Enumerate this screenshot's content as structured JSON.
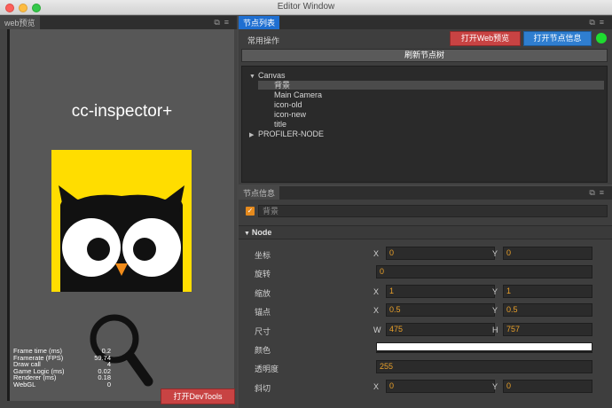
{
  "window": {
    "title": "Editor Window"
  },
  "left_panel": {
    "tab": "web预览",
    "game_title": "cc-inspector+",
    "stats": [
      {
        "label": "Frame time (ms)",
        "value": "0.2"
      },
      {
        "label": "Framerate (FPS)",
        "value": "59.74"
      },
      {
        "label": "Draw call",
        "value": "4"
      },
      {
        "label": "Game Logic (ms)",
        "value": "0.02"
      },
      {
        "label": "Renderer (ms)",
        "value": "0.18"
      },
      {
        "label": "WebGL",
        "value": "0"
      }
    ],
    "devtools_button": "打开DevTools"
  },
  "node_list": {
    "tab": "节点列表",
    "common_ops": "常用操作",
    "open_web_button": "打开Web预览",
    "open_info_button": "打开节点信息",
    "refresh_button": "刷新节点树",
    "tree": [
      {
        "label": "Canvas",
        "expanded": true,
        "children": [
          "背景",
          "Main Camera",
          "icon-old",
          "icon-new",
          "title"
        ]
      },
      {
        "label": "PROFILER-NODE",
        "expanded": false
      }
    ]
  },
  "node_info": {
    "tab": "节点信息",
    "node_name": "背景",
    "section": "Node",
    "props": {
      "position": {
        "label": "坐标",
        "x": "0",
        "y": "0"
      },
      "rotation": {
        "label": "旋转",
        "value": "0"
      },
      "scale": {
        "label": "缩放",
        "x": "1",
        "y": "1"
      },
      "anchor": {
        "label": "锚点",
        "x": "0.5",
        "y": "0.5"
      },
      "size": {
        "label": "尺寸",
        "w": "475",
        "h": "757"
      },
      "color": {
        "label": "颜色",
        "value": "#ffffff"
      },
      "opacity": {
        "label": "透明度",
        "value": "255"
      },
      "skew": {
        "label": "斜切",
        "x": "0",
        "y": "0"
      }
    },
    "axis_labels": {
      "x": "X",
      "y": "Y",
      "w": "W",
      "h": "H"
    }
  },
  "colors": {
    "accent_tab": "#1f6fd1",
    "danger_button": "#c84343",
    "info_button": "#2f7ed0",
    "value_text": "#e9a02a",
    "status_green": "#1edc30"
  }
}
